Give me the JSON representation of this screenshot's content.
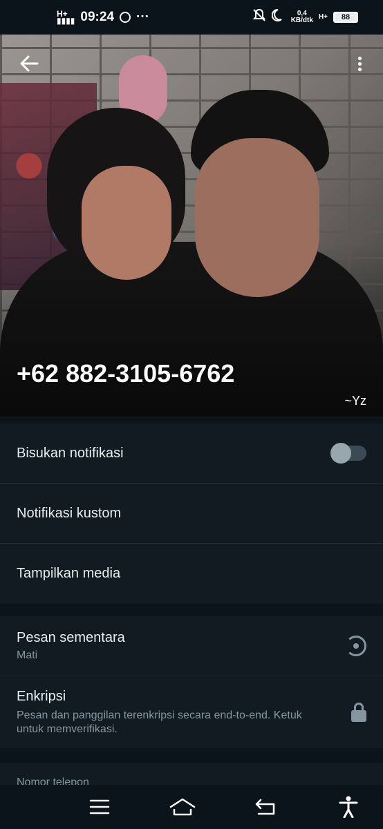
{
  "status_bar": {
    "time": "09:24",
    "network_left": "H+",
    "speed_value": "0,4",
    "speed_unit": "KB/dtk",
    "network_right": "H+",
    "battery": "88",
    "more_indicator": "···"
  },
  "header": {
    "phone_number": "+62 882-3105-6762",
    "alias": "~Yz"
  },
  "notifications": {
    "mute_label": "Bisukan notifikasi",
    "mute_enabled": false,
    "custom_label": "Notifikasi kustom",
    "media_label": "Tampilkan media"
  },
  "privacy": {
    "disappearing_title": "Pesan sementara",
    "disappearing_value": "Mati",
    "encryption_title": "Enkripsi",
    "encryption_desc": "Pesan dan panggilan terenkripsi secara end-to-end. Ketuk untuk memverifikasi."
  },
  "phone_section": {
    "label": "Nomor telepon"
  },
  "icons": {
    "back": "arrow-left-icon",
    "menu": "more-vertical-icon",
    "timer": "timer-icon",
    "lock": "lock-icon",
    "nav_menu": "menu-icon",
    "nav_home": "home-icon",
    "nav_back": "back-icon",
    "nav_accessibility": "accessibility-icon"
  },
  "colors": {
    "background": "#0b141a",
    "panel": "#111b21",
    "secondary_text": "#8696a0"
  }
}
